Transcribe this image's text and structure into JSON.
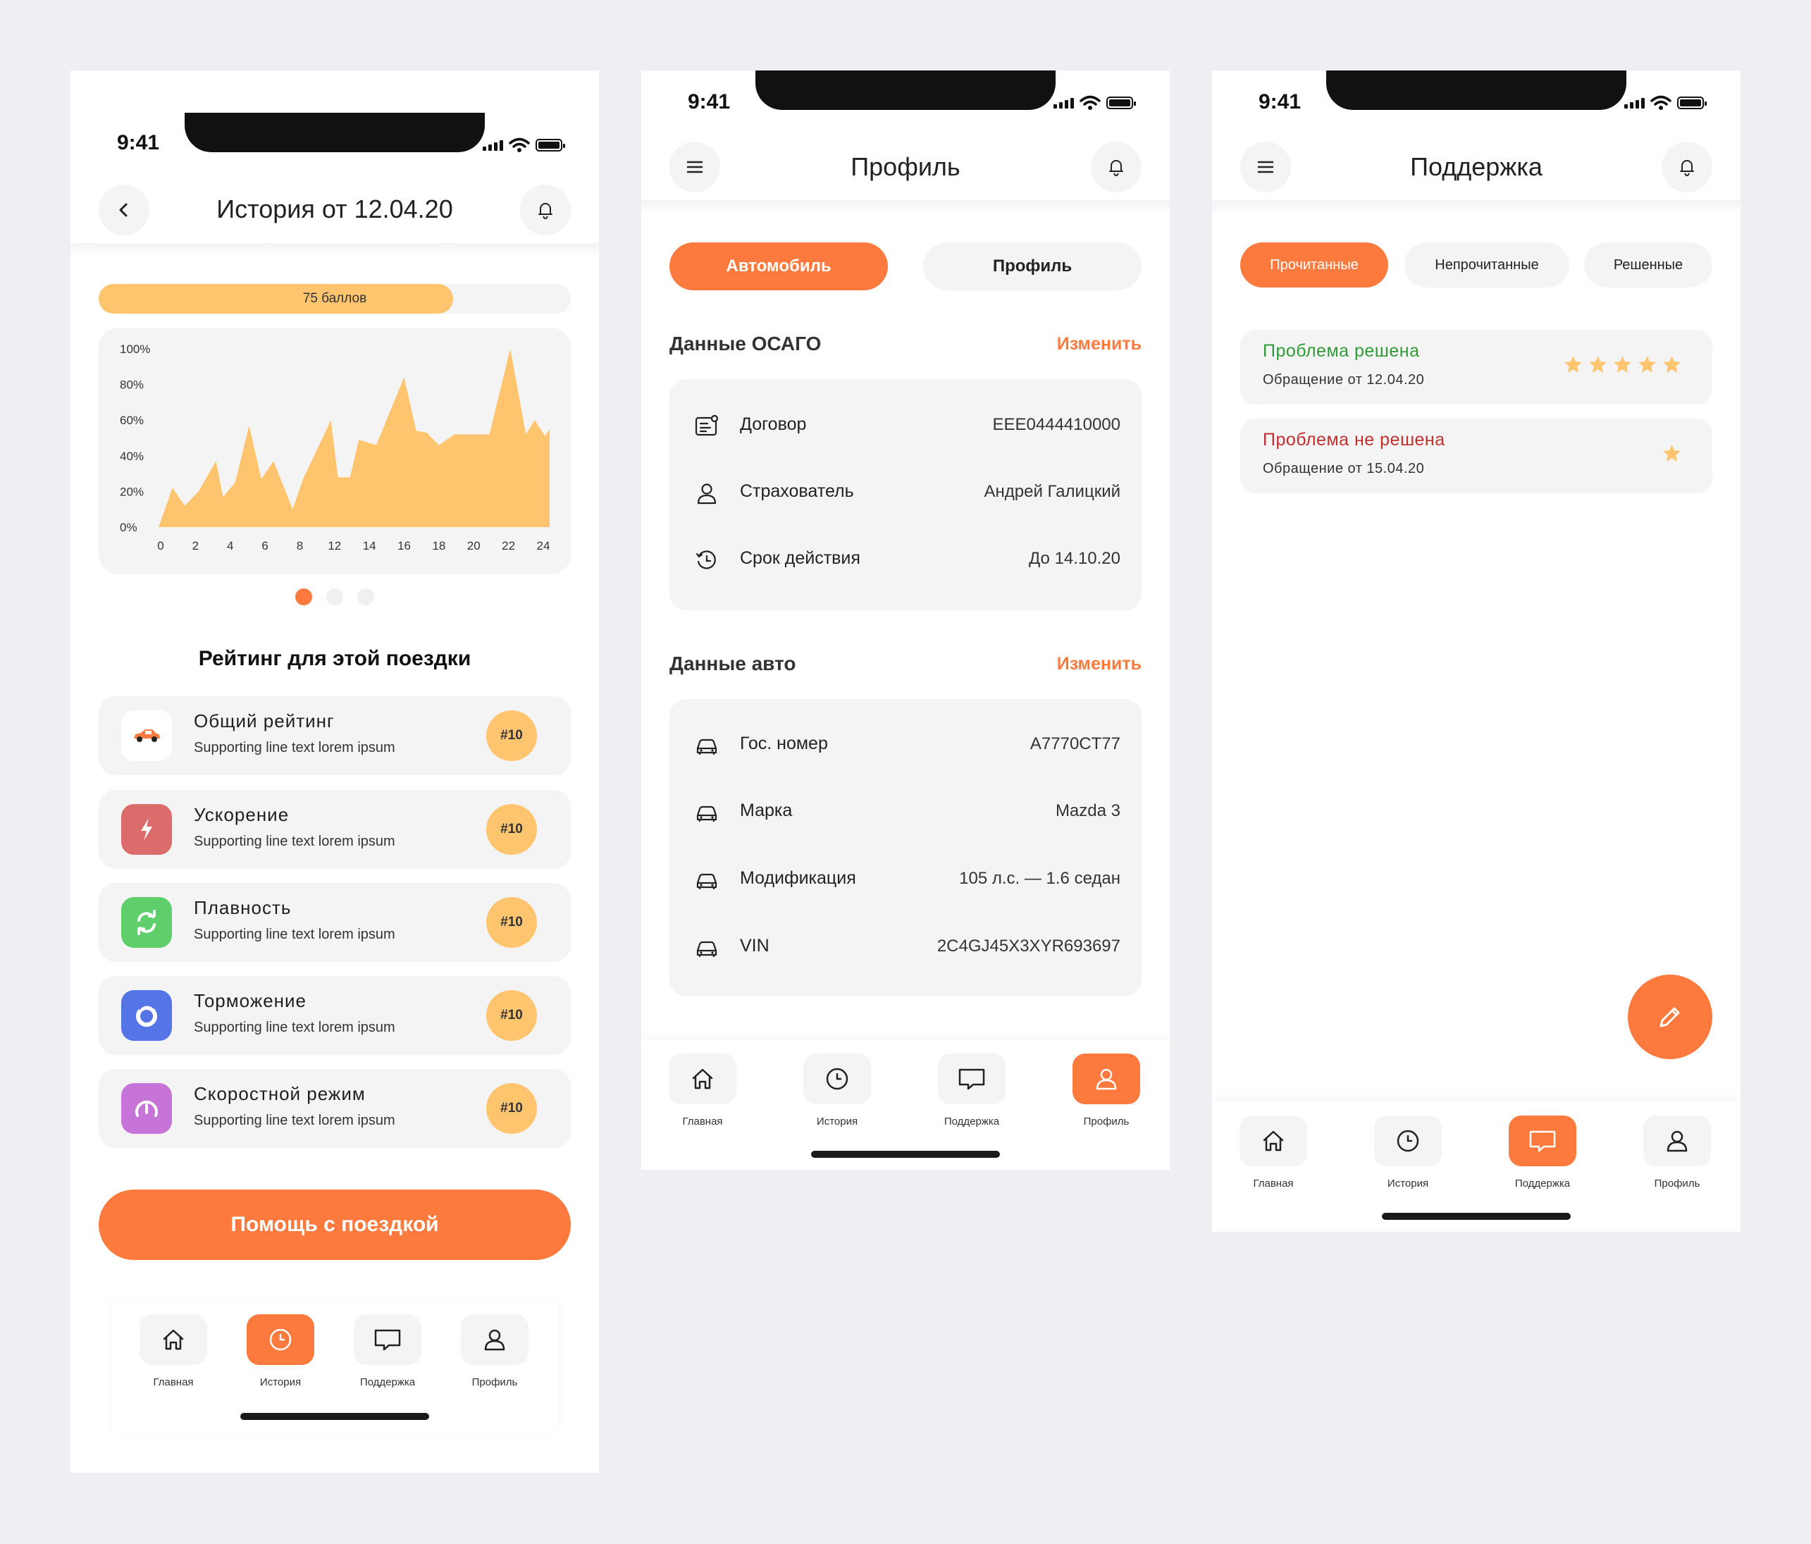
{
  "status_time": "9:41",
  "colors": {
    "accent": "#fd7a3e",
    "chart_fill": "#ffc46e",
    "card": "#f4f4f4",
    "resolved": "#2f9b37",
    "unresolved": "#c0302f",
    "star": "#ffc46e"
  },
  "history": {
    "title": "История от 12.04.20",
    "progress": {
      "label": "75 баллов",
      "fraction": 0.75
    },
    "section_title": "Рейтинг для этой поездки",
    "ratings": [
      {
        "title": "Общий рейтинг",
        "subtitle": "Supporting line text lorem ipsum",
        "badge": "#10",
        "icon": "car-icon"
      },
      {
        "title": "Ускорение",
        "subtitle": "Supporting line text lorem ipsum",
        "badge": "#10",
        "icon": "lightning-icon"
      },
      {
        "title": "Плавность",
        "subtitle": "Supporting line text lorem ipsum",
        "badge": "#10",
        "icon": "refresh-icon"
      },
      {
        "title": "Торможение",
        "subtitle": "Supporting line text lorem ipsum",
        "badge": "#10",
        "icon": "brake-icon"
      },
      {
        "title": "Скоростной режим",
        "subtitle": "Supporting line text lorem ipsum",
        "badge": "#10",
        "icon": "speedometer-icon"
      }
    ],
    "help_button": "Помощь с поездкой",
    "carousel": {
      "pages": 3,
      "active": 0
    }
  },
  "chart_data": {
    "type": "area",
    "y_ticks": [
      "100%",
      "80%",
      "60%",
      "40%",
      "20%",
      "0%"
    ],
    "x_ticks": [
      "0",
      "2",
      "4",
      "6",
      "8",
      "12",
      "14",
      "16",
      "18",
      "20",
      "22",
      "24"
    ],
    "ylim": [
      0,
      100
    ],
    "xlim": [
      0,
      24
    ],
    "grid": false,
    "points": [
      [
        0,
        0
      ],
      [
        0.8,
        22
      ],
      [
        1.5,
        12
      ],
      [
        2.3,
        20
      ],
      [
        3.3,
        37
      ],
      [
        3.7,
        17
      ],
      [
        4.4,
        25
      ],
      [
        5.2,
        57
      ],
      [
        5.9,
        27
      ],
      [
        6.6,
        37
      ],
      [
        7.7,
        10
      ],
      [
        8.3,
        27
      ],
      [
        9.9,
        60
      ],
      [
        10.3,
        28
      ],
      [
        11.0,
        28
      ],
      [
        11.5,
        49
      ],
      [
        12.5,
        46
      ],
      [
        14.1,
        84
      ],
      [
        14.8,
        54
      ],
      [
        15.4,
        53
      ],
      [
        16.1,
        46
      ],
      [
        17.0,
        52
      ],
      [
        18.0,
        52
      ],
      [
        19.0,
        52
      ],
      [
        20.2,
        100
      ],
      [
        21.1,
        52
      ],
      [
        21.6,
        60
      ],
      [
        22.2,
        51
      ],
      [
        22.7,
        55
      ],
      [
        23.2,
        57
      ],
      [
        24.0,
        84
      ],
      [
        24,
        0
      ]
    ]
  },
  "profile": {
    "title": "Профиль",
    "tabs": [
      "Автомобиль",
      "Профиль"
    ],
    "osago": {
      "heading": "Данные ОСАГО",
      "edit": "Изменить",
      "rows": [
        {
          "label": "Договор",
          "value": "EEE0444410000",
          "icon": "document-icon"
        },
        {
          "label": "Страхователь",
          "value": "Андрей Галицкий",
          "icon": "person-icon"
        },
        {
          "label": "Срок действия",
          "value": "До 14.10.20",
          "icon": "clock-history-icon"
        }
      ]
    },
    "car": {
      "heading": "Данные авто",
      "edit": "Изменить",
      "rows": [
        {
          "label": "Гос. номер",
          "value": "A7770CT77",
          "icon": "car-icon"
        },
        {
          "label": "Марка",
          "value": "Mazda 3",
          "icon": "car-icon"
        },
        {
          "label": "Модификация",
          "value": "105 л.с. — 1.6 седан",
          "icon": "car-icon"
        },
        {
          "label": "VIN",
          "value": "2C4GJ45X3XYR693697",
          "icon": "car-icon"
        }
      ]
    }
  },
  "support": {
    "title": "Поддержка",
    "filters": [
      "Прочитанные",
      "Непрочитанные",
      "Решенные"
    ],
    "tickets": [
      {
        "status": "Проблема решена",
        "date": "Обращение от 12.04.20",
        "stars": 5
      },
      {
        "status": "Проблема не решена",
        "date": "Обращение от 15.04.20",
        "stars": 1
      }
    ]
  },
  "nav": [
    {
      "label": "Главная",
      "icon": "home-icon"
    },
    {
      "label": "История",
      "icon": "clock-icon"
    },
    {
      "label": "Поддержка",
      "icon": "chat-icon"
    },
    {
      "label": "Профиль",
      "icon": "user-icon"
    }
  ]
}
